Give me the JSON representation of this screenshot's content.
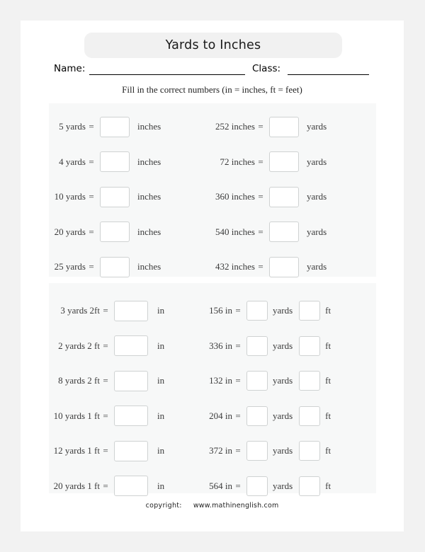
{
  "title": "Yards to Inches",
  "fields": {
    "name_label": "Name:",
    "class_label": "Class:"
  },
  "instruction": "Fill in the correct numbers (in = inches, ft = feet)",
  "sections": [
    {
      "id": "section-1",
      "left_column": [
        {
          "prompt": "5 yards",
          "equals": "=",
          "unit": "inches"
        },
        {
          "prompt": "4 yards",
          "equals": "=",
          "unit": "inches"
        },
        {
          "prompt": "10 yards",
          "equals": "=",
          "unit": "inches"
        },
        {
          "prompt": "20 yards",
          "equals": "=",
          "unit": "inches"
        },
        {
          "prompt": "25 yards",
          "equals": "=",
          "unit": "inches"
        }
      ],
      "right_column": [
        {
          "prompt": "252 inches",
          "equals": "=",
          "unit": "yards"
        },
        {
          "prompt": "72 inches",
          "equals": "=",
          "unit": "yards"
        },
        {
          "prompt": "360 inches",
          "equals": "=",
          "unit": "yards"
        },
        {
          "prompt": "540 inches",
          "equals": "=",
          "unit": "yards"
        },
        {
          "prompt": "432 inches",
          "equals": "=",
          "unit": "yards"
        }
      ]
    },
    {
      "id": "section-2",
      "left_column": [
        {
          "prompt": "3 yards 2ft",
          "equals": "=",
          "unit": "in"
        },
        {
          "prompt": "2 yards 2 ft",
          "equals": "=",
          "unit": "in"
        },
        {
          "prompt": "8 yards 2 ft",
          "equals": "=",
          "unit": "in"
        },
        {
          "prompt": "10 yards 1 ft",
          "equals": "=",
          "unit": "in"
        },
        {
          "prompt": "12 yards 1 ft",
          "equals": "=",
          "unit": "in"
        },
        {
          "prompt": "20 yards 1 ft",
          "equals": "=",
          "unit": "in"
        }
      ],
      "right_column": [
        {
          "prompt": "156 in",
          "equals": "=",
          "unit1": "yards",
          "unit2": "ft"
        },
        {
          "prompt": "336 in",
          "equals": "=",
          "unit1": "yards",
          "unit2": "ft"
        },
        {
          "prompt": "132 in",
          "equals": "=",
          "unit1": "yards",
          "unit2": "ft"
        },
        {
          "prompt": "204 in",
          "equals": "=",
          "unit1": "yards",
          "unit2": "ft"
        },
        {
          "prompt": "372 in",
          "equals": "=",
          "unit1": "yards",
          "unit2": "ft"
        },
        {
          "prompt": "564 in",
          "equals": "=",
          "unit1": "yards",
          "unit2": "ft"
        }
      ]
    }
  ],
  "footer": {
    "copyright": "copyright:",
    "url": "www.mathinenglish.com"
  },
  "colors": {
    "page_backdrop": "#f2f2f2",
    "sheet": "#ffffff",
    "banner": "#f1f1f1",
    "panel": "#f7f8f8",
    "box_border": "#cfd2d2",
    "text": "#3a3a3a"
  }
}
